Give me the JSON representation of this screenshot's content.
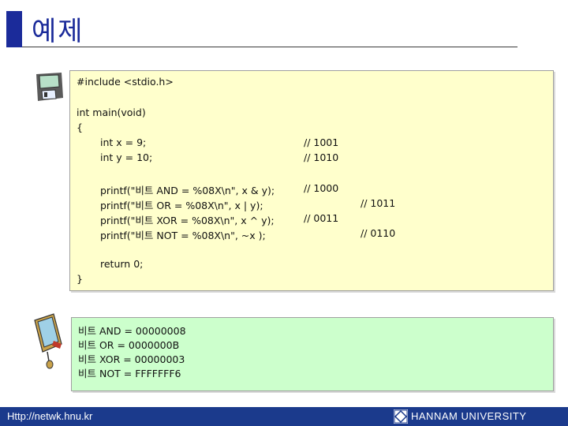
{
  "slide": {
    "title": "예제",
    "accent_color": "#1b2b9a"
  },
  "code": {
    "lines": [
      {
        "text": "#include <stdio.h>"
      },
      {
        "text": "int main(void)"
      },
      {
        "text": "{"
      },
      {
        "text": "int x = 9;",
        "comment": "// 1001"
      },
      {
        "text": "int y = 10;",
        "comment": "// 1010"
      },
      {
        "text": "printf(\"비트 AND = %08X\\n\", x & y);",
        "comment": "// 1000"
      },
      {
        "text": "printf(\"비트 OR = %08X\\n\", x | y);",
        "comment": "// 1011"
      },
      {
        "text": "printf(\"비트 XOR = %08X\\n\", x ^ y);",
        "comment": "// 0011"
      },
      {
        "text": "printf(\"비트 NOT = %08X\\n\", ~x );",
        "comment": "// 0110"
      },
      {
        "text": "return 0;"
      },
      {
        "text": "}"
      }
    ]
  },
  "output": {
    "lines": [
      "비트 AND = 00000008",
      "비트 OR = 0000000B",
      "비트 XOR = 00000003",
      "비트 NOT = FFFFFFF6"
    ]
  },
  "footer": {
    "url": "Http://netwk.hnu.kr",
    "university": "HANNAM UNIVERSITY"
  },
  "icons": {
    "code_icon": "floppy-disk-icon",
    "output_icon": "monitor-icon"
  }
}
